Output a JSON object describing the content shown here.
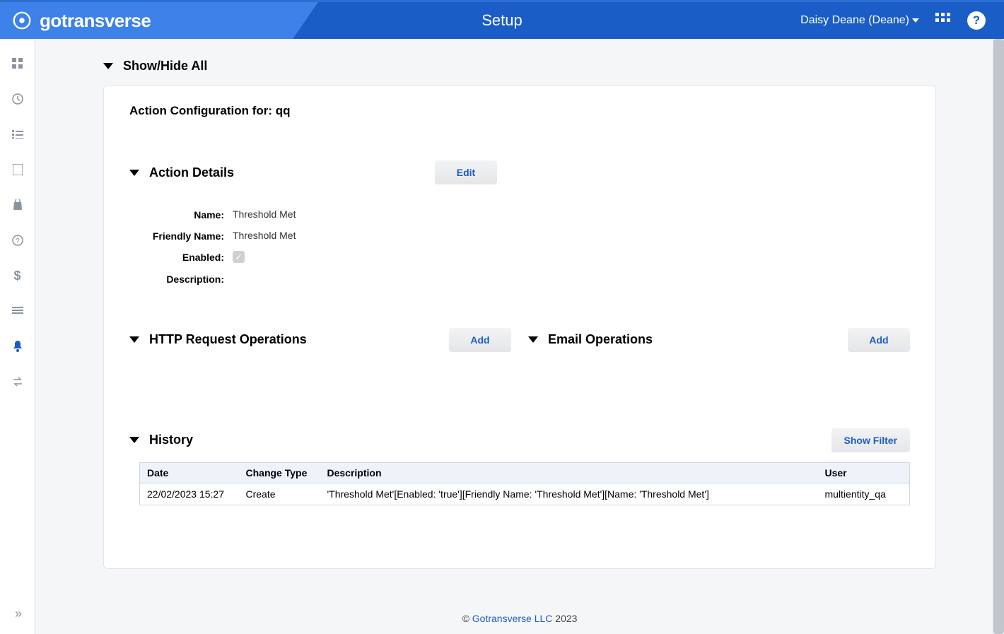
{
  "brand": "gotransverse",
  "page_title": "Setup",
  "user": {
    "display": "Daisy Deane (Deane)"
  },
  "showhide_label": "Show/Hide All",
  "card_title": "Action Configuration for: qq",
  "action_details": {
    "heading": "Action Details",
    "edit_btn": "Edit",
    "rows": {
      "name_label": "Name:",
      "name_value": "Threshold Met",
      "friendly_label": "Friendly Name:",
      "friendly_value": "Threshold Met",
      "enabled_label": "Enabled:",
      "enabled_checked": true,
      "desc_label": "Description:",
      "desc_value": ""
    }
  },
  "http_ops": {
    "heading": "HTTP Request Operations",
    "add_btn": "Add"
  },
  "email_ops": {
    "heading": "Email Operations",
    "add_btn": "Add"
  },
  "history": {
    "heading": "History",
    "show_filter_btn": "Show Filter",
    "headers": {
      "date": "Date",
      "change_type": "Change Type",
      "description": "Description",
      "user": "User"
    },
    "row": {
      "date": "22/02/2023 15:27",
      "change_type": "Create",
      "description": "'Threshold Met'[Enabled: 'true'][Friendly Name: 'Threshold Met'][Name: 'Threshold Met']",
      "user": "multientity_qa"
    }
  },
  "footer": {
    "prefix": "© ",
    "link": "Gotransverse LLC",
    "suffix": " 2023"
  },
  "sidebar_icons": [
    "grid-icon",
    "clock-icon",
    "list-icon",
    "note-icon",
    "bag-icon",
    "help-icon",
    "dollar-icon",
    "lines-icon",
    "bell-icon",
    "swap-icon"
  ]
}
